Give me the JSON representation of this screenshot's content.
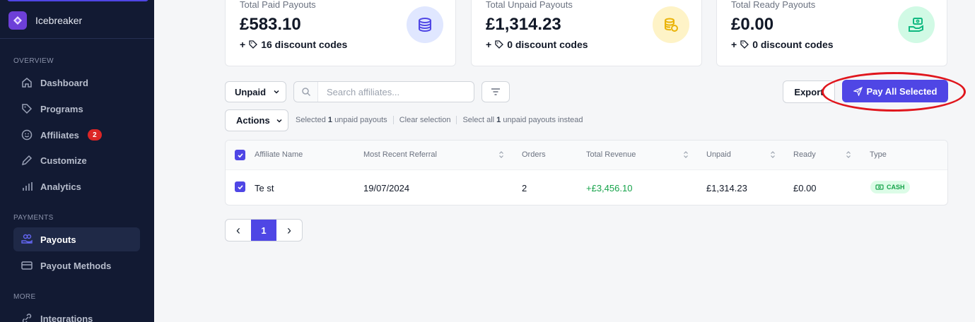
{
  "sidebar": {
    "brand": "Icebreaker",
    "sections": {
      "overview": "OVERVIEW",
      "payments": "PAYMENTS",
      "more": "MORE"
    },
    "items": [
      {
        "label": "Dashboard",
        "icon": "home-icon"
      },
      {
        "label": "Programs",
        "icon": "tag-icon"
      },
      {
        "label": "Affiliates",
        "icon": "smiley-icon",
        "badge": "2"
      },
      {
        "label": "Customize",
        "icon": "pen-icon"
      },
      {
        "label": "Analytics",
        "icon": "bar-chart-icon"
      },
      {
        "label": "Payouts",
        "icon": "hand-coins-icon",
        "active": true
      },
      {
        "label": "Payout Methods",
        "icon": "credit-card-icon"
      },
      {
        "label": "Integrations",
        "icon": "link-icon"
      }
    ]
  },
  "cards": [
    {
      "label": "Total Paid Payouts",
      "value": "£583.10",
      "plus": "+",
      "codes": "16 discount codes",
      "icon": "coins-stack-icon",
      "color": "#4f46e5"
    },
    {
      "label": "Total Unpaid Payouts",
      "value": "£1,314.23",
      "plus": "+",
      "codes": "0 discount codes",
      "icon": "coins-clock-icon",
      "color": "#eab308"
    },
    {
      "label": "Total Ready Payouts",
      "value": "£0.00",
      "plus": "+",
      "codes": "0 discount codes",
      "icon": "hand-money-icon",
      "color": "#10b981"
    }
  ],
  "toolbar": {
    "filter_select": "Unpaid",
    "search_placeholder": "Search affiliates...",
    "export_label": "Export",
    "pay_label": "Pay All Selected",
    "actions_label": "Actions"
  },
  "selection": {
    "selected_prefix": "Selected",
    "selected_count": "1",
    "selected_suffix": "unpaid payouts",
    "clear": "Clear selection",
    "select_all_prefix": "Select all",
    "select_all_count": "1",
    "select_all_suffix": "unpaid payouts instead"
  },
  "table": {
    "columns": [
      "Affiliate Name",
      "Most Recent Referral",
      "Orders",
      "Total Revenue",
      "Unpaid",
      "Ready",
      "Type"
    ],
    "rows": [
      {
        "name": "Te st",
        "referral": "19/07/2024",
        "orders": "2",
        "revenue": "+£3,456.10",
        "unpaid": "£1,314.23",
        "ready": "£0.00",
        "type": "CASH"
      }
    ]
  },
  "pagination": {
    "prev": "‹",
    "current": "1",
    "next": "›"
  },
  "colors": {
    "accent": "#4f46e5",
    "sidebar_bg": "#121a33",
    "success": "#16a34a",
    "highlight": "#e0161d"
  }
}
